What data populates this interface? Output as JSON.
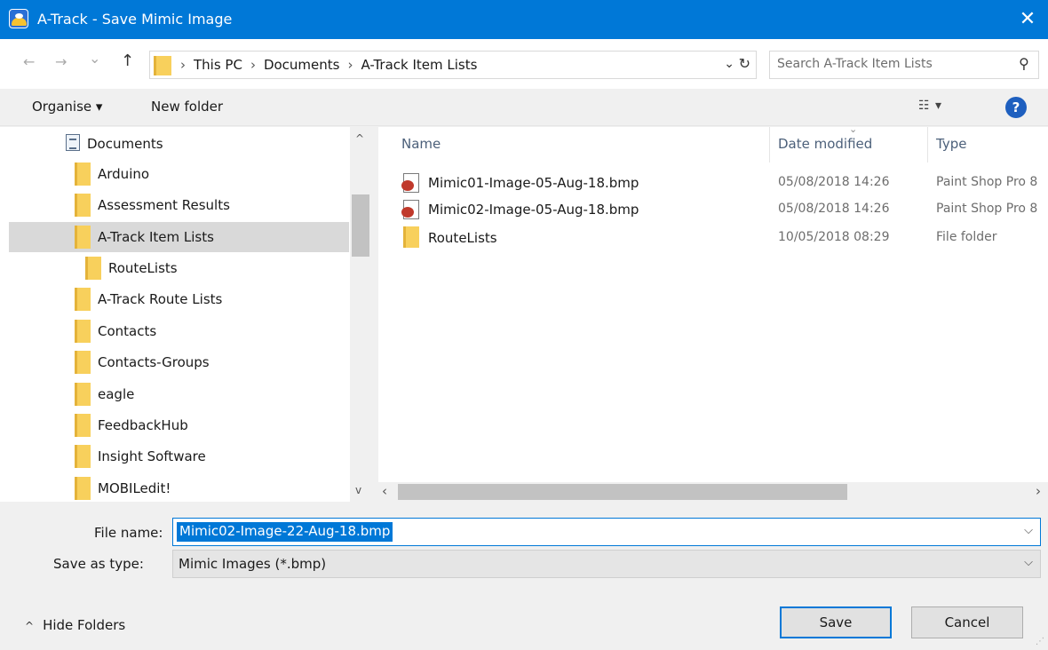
{
  "window": {
    "title": "A-Track - Save Mimic Image",
    "close_glyph": "✕"
  },
  "address": {
    "back_glyph": "←",
    "forward_glyph": "→",
    "recent_glyph": "⌄",
    "up_glyph": "↑",
    "crumbs": [
      "This PC",
      "Documents",
      "A-Track Item Lists"
    ],
    "separator": "›",
    "dropdown_glyph": "⌄",
    "refresh_glyph": "↻",
    "search_placeholder": "Search A-Track Item Lists",
    "search_glyph": "⚲"
  },
  "toolbar": {
    "organise_label": "Organise ▾",
    "new_folder_label": "New folder",
    "view_glyph": "☷ ▾",
    "help_glyph": "?"
  },
  "navigation": {
    "items": [
      {
        "label": "Documents",
        "kind": "documents"
      },
      {
        "label": "Arduino",
        "kind": "folder"
      },
      {
        "label": "Assessment Results",
        "kind": "folder"
      },
      {
        "label": "A-Track Item Lists",
        "kind": "folder",
        "selected": true
      },
      {
        "label": "RouteLists",
        "kind": "folder"
      },
      {
        "label": "A-Track Route Lists",
        "kind": "folder"
      },
      {
        "label": "Contacts",
        "kind": "folder"
      },
      {
        "label": "Contacts-Groups",
        "kind": "folder"
      },
      {
        "label": "eagle",
        "kind": "folder"
      },
      {
        "label": "FeedbackHub",
        "kind": "folder"
      },
      {
        "label": "Insight Software",
        "kind": "folder"
      },
      {
        "label": "MOBILedit!",
        "kind": "folder"
      }
    ],
    "scroll_up_glyph": "^",
    "scroll_down_glyph": "v"
  },
  "files": {
    "columns": {
      "name": "Name",
      "date": "Date modified",
      "type": "Type"
    },
    "sort_glyph": "⌄",
    "rows": [
      {
        "name": "Mimic01-Image-05-Aug-18.bmp",
        "date": "05/08/2018 14:26",
        "type": "Paint Shop Pro 8",
        "kind": "bmp"
      },
      {
        "name": "Mimic02-Image-05-Aug-18.bmp",
        "date": "05/08/2018 14:26",
        "type": "Paint Shop Pro 8",
        "kind": "bmp"
      },
      {
        "name": "RouteLists",
        "date": "10/05/2018 08:29",
        "type": "File folder",
        "kind": "folder"
      }
    ],
    "scroll_left_glyph": "‹",
    "scroll_right_glyph": "›"
  },
  "form": {
    "file_name_label": "File name:",
    "file_name_value": "Mimic02-Image-22-Aug-18.bmp",
    "save_type_label": "Save as type:",
    "save_type_value": "Mimic Images (*.bmp)",
    "dropdown_glyph": "⌵"
  },
  "footer": {
    "hide_folders_glyph": "^",
    "hide_folders_label": "Hide Folders",
    "save_label": "Save",
    "cancel_label": "Cancel"
  },
  "colors": {
    "accent": "#0078d7",
    "selection": "#d9d9d9",
    "folder": "#f8d05c"
  }
}
